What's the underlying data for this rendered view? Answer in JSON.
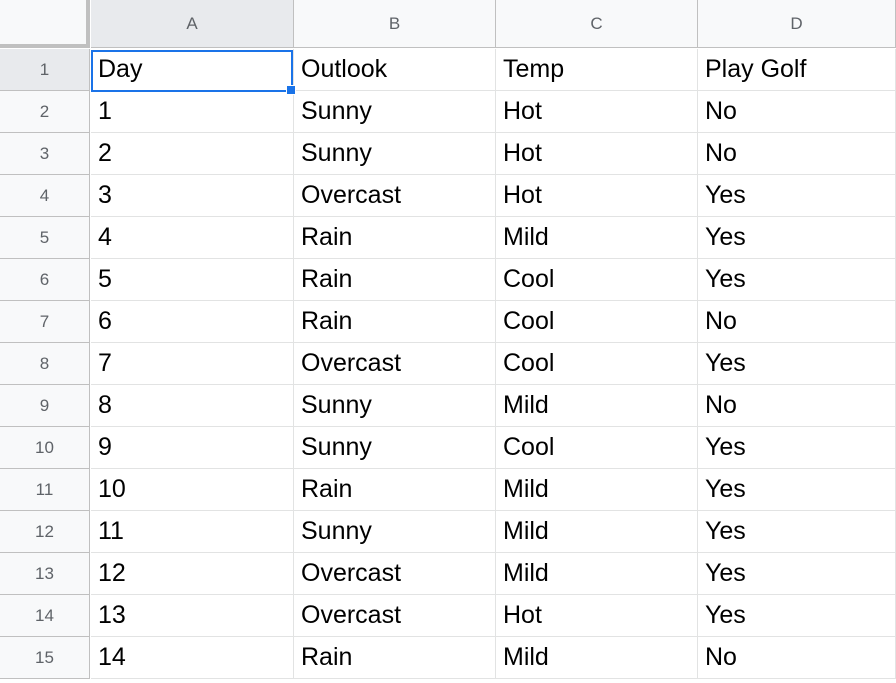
{
  "columns": [
    "A",
    "B",
    "C",
    "D"
  ],
  "rows": [
    "1",
    "2",
    "3",
    "4",
    "5",
    "6",
    "7",
    "8",
    "9",
    "10",
    "11",
    "12",
    "13",
    "14",
    "15"
  ],
  "cells": [
    [
      "Day",
      "Outlook",
      "Temp",
      "Play Golf"
    ],
    [
      "1",
      "Sunny",
      "Hot",
      "No"
    ],
    [
      "2",
      "Sunny",
      "Hot",
      "No"
    ],
    [
      "3",
      "Overcast",
      "Hot",
      "Yes"
    ],
    [
      "4",
      "Rain",
      "Mild",
      "Yes"
    ],
    [
      "5",
      "Rain",
      "Cool",
      "Yes"
    ],
    [
      "6",
      "Rain",
      "Cool",
      "No"
    ],
    [
      "7",
      "Overcast",
      "Cool",
      "Yes"
    ],
    [
      "8",
      "Sunny",
      "Mild",
      "No"
    ],
    [
      "9",
      "Sunny",
      "Cool",
      "Yes"
    ],
    [
      "10",
      "Rain",
      "Mild",
      "Yes"
    ],
    [
      "11",
      "Sunny",
      "Mild",
      "Yes"
    ],
    [
      "12",
      "Overcast",
      "Mild",
      "Yes"
    ],
    [
      "13",
      "Overcast",
      "Hot",
      "Yes"
    ],
    [
      "14",
      "Rain",
      "Mild",
      "No"
    ]
  ],
  "selected_cell": "A1",
  "colors": {
    "selection": "#1a73e8",
    "header_bg": "#f8f9fa",
    "grid_line": "#e2e3e3"
  }
}
